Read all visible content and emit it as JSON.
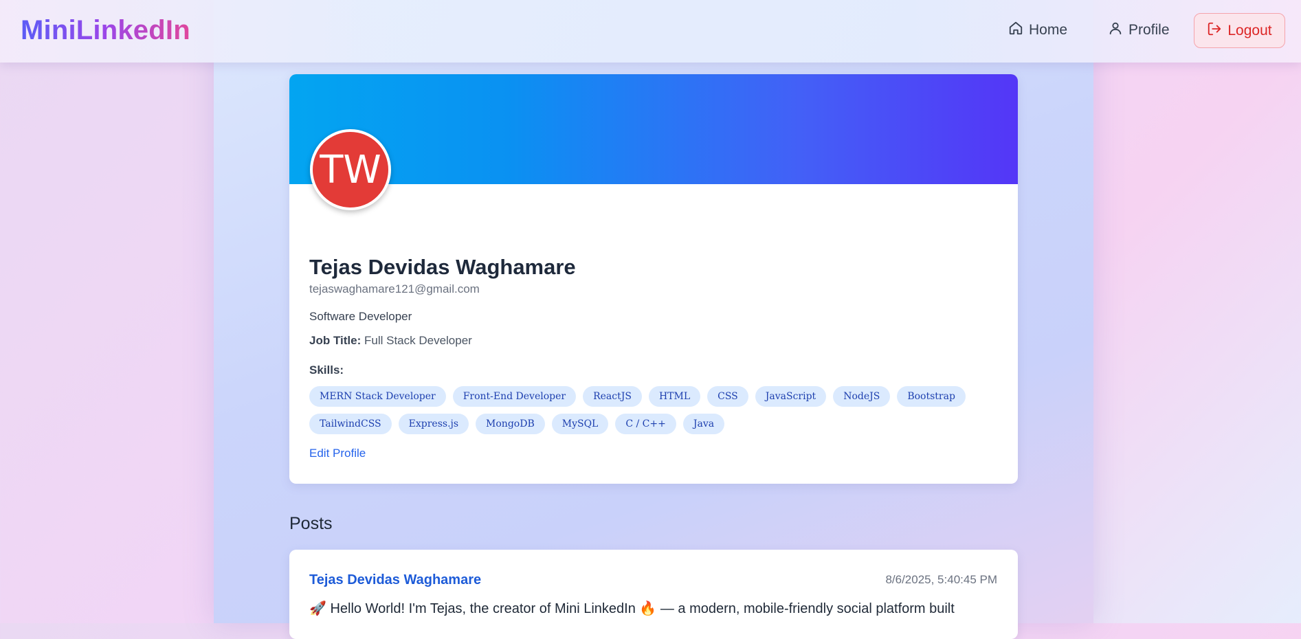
{
  "app": {
    "brand": "MiniLinkedIn"
  },
  "nav": {
    "home_label": "Home",
    "profile_label": "Profile",
    "logout_label": "Logout"
  },
  "profile": {
    "initials": "TW",
    "name": "Tejas Devidas Waghamare",
    "email": "tejaswaghamare121@gmail.com",
    "bio": "Software Developer",
    "job_title_label": "Job Title:",
    "job_title": "Full Stack Developer",
    "skills_label": "Skills:",
    "skills": [
      "MERN Stack Developer",
      "Front-End Developer",
      "ReactJS",
      "HTML",
      "CSS",
      "JavaScript",
      "NodeJS",
      "Bootstrap",
      "TailwindCSS",
      "Express.js",
      "MongoDB",
      "MySQL",
      "C / C++",
      "Java"
    ],
    "edit_label": "Edit Profile"
  },
  "posts": {
    "heading": "Posts",
    "items": [
      {
        "author": "Tejas Devidas Waghamare",
        "timestamp": "8/6/2025, 5:40:45 PM",
        "content": "🚀 Hello World! I'm Tejas, the creator of Mini LinkedIn 🔥 — a modern, mobile-friendly social platform built"
      }
    ]
  },
  "colors": {
    "brand_gradient": [
      "#5b5cf6",
      "#9b46e8",
      "#e0479c"
    ],
    "cover_gradient": [
      "#03a5f1",
      "#5436f7"
    ],
    "avatar_bg": "#e33b37",
    "link": "#2563eb",
    "logout": "#dc2626",
    "chip_bg": "#dbeafe"
  },
  "icons": {
    "home": "home-icon",
    "profile": "user-icon",
    "logout": "logout-icon"
  }
}
